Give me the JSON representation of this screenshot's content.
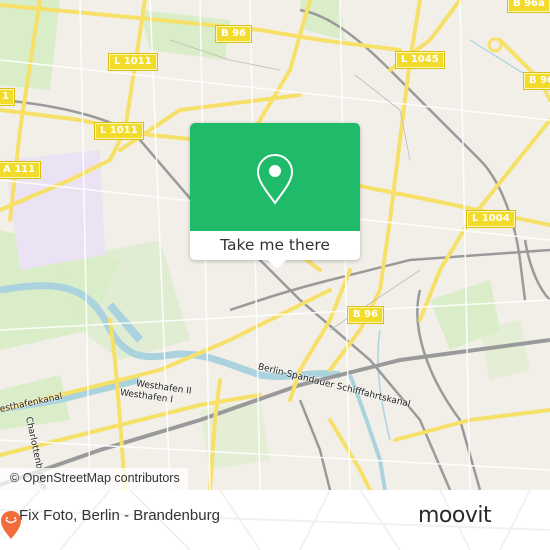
{
  "map": {
    "attribution": "© OpenStreetMap contributors",
    "road_labels": [
      {
        "id": "b96-top",
        "text": "B 96"
      },
      {
        "id": "b96a",
        "text": "B 96a"
      },
      {
        "id": "l1011-upper",
        "text": "L 1011"
      },
      {
        "id": "l1011-left-edge",
        "text": "1"
      },
      {
        "id": "l1011-lower",
        "text": "L 1011"
      },
      {
        "id": "l1045",
        "text": "L 1045"
      },
      {
        "id": "b96-right",
        "text": "B 96"
      },
      {
        "id": "a111",
        "text": "A 111"
      },
      {
        "id": "l1004",
        "text": "L 1004"
      },
      {
        "id": "b96-mid",
        "text": "B 96"
      }
    ],
    "water_labels": [
      {
        "id": "westhafen-ii",
        "text": "Westhafen II"
      },
      {
        "id": "westhafen-i",
        "text": "Westhafen I"
      },
      {
        "id": "westhafenkanal",
        "text": "esthafenkanal"
      },
      {
        "id": "charlottenburger",
        "text": "Charlottenburger"
      },
      {
        "id": "berlin-spandauer",
        "text": "Berlin-Spandauer Schifffahrtskanal"
      }
    ],
    "colors": {
      "land": "#f2efe9",
      "park": "#d7ecc4",
      "water": "#aad3df",
      "major_road": "#f7e068",
      "rail": "#8a8a8a",
      "industrial": "#ebe2f3"
    }
  },
  "popup": {
    "icon": "location-pin-icon",
    "button_label": "Take me there",
    "accent_color": "#1fba6a"
  },
  "footer": {
    "place_name": "Fix Foto, Berlin - Brandenburg",
    "brand": "moovit",
    "brand_color": "#f26b3a"
  }
}
